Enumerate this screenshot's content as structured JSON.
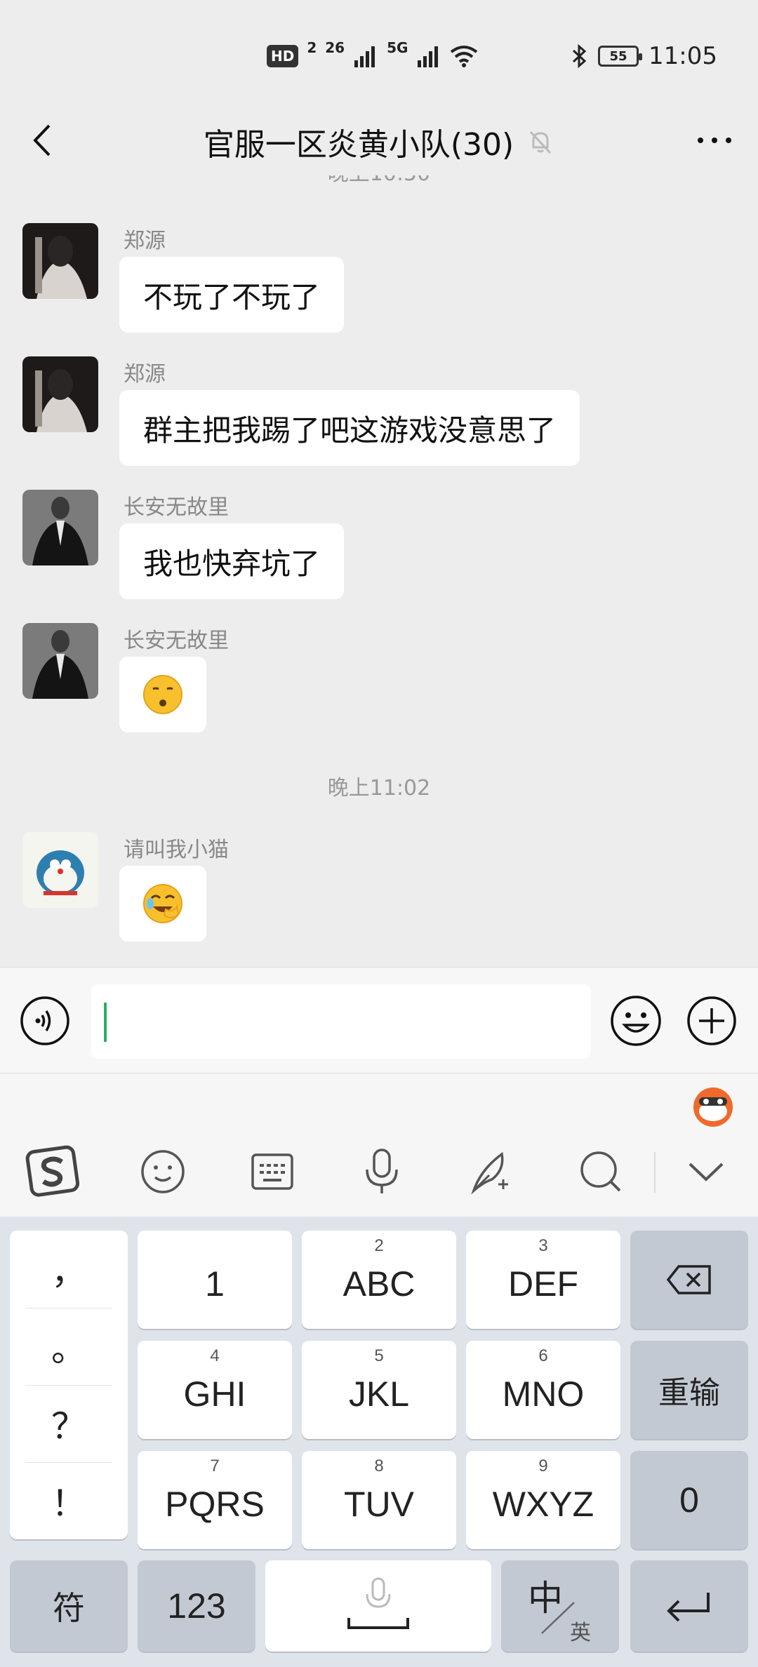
{
  "status_bar": {
    "hd": "HD",
    "hd_sub": "2",
    "sig1": "26",
    "sig2": "5G",
    "battery": "55",
    "time": "11:05"
  },
  "header": {
    "title": "官服一区炎黄小队(30)"
  },
  "messages": {
    "partial_time": "晚上10:50",
    "items": [
      {
        "sender": "郑源",
        "text": "不玩了不玩了"
      },
      {
        "sender": "郑源",
        "text": "群主把我踢了吧这游戏没意思了"
      },
      {
        "sender": "长安无故里",
        "text": "我也快弃坑了"
      },
      {
        "sender": "长安无故里",
        "emoji": "😗"
      },
      {
        "sender": "请叫我小猫",
        "emoji": "🤭"
      }
    ],
    "time_separator": "晚上11:02"
  },
  "input": {
    "value": ""
  },
  "keyboard": {
    "punct": [
      "，",
      "。",
      "？",
      "！"
    ],
    "rows": [
      [
        {
          "sub": "",
          "main": "1"
        },
        {
          "sub": "2",
          "main": "ABC"
        },
        {
          "sub": "3",
          "main": "DEF"
        }
      ],
      [
        {
          "sub": "4",
          "main": "GHI"
        },
        {
          "sub": "5",
          "main": "JKL"
        },
        {
          "sub": "6",
          "main": "MNO"
        }
      ],
      [
        {
          "sub": "7",
          "main": "PQRS"
        },
        {
          "sub": "8",
          "main": "TUV"
        },
        {
          "sub": "9",
          "main": "WXYZ"
        }
      ]
    ],
    "reset_label": "重输",
    "zero_label": "0",
    "symbol_label": "符",
    "num_label": "123",
    "lang_main": "中",
    "lang_sub": "英"
  },
  "colors": {
    "accent_green": "#2aae67",
    "bg": "#ededed",
    "keyboard_bg": "#dfe3ea"
  }
}
